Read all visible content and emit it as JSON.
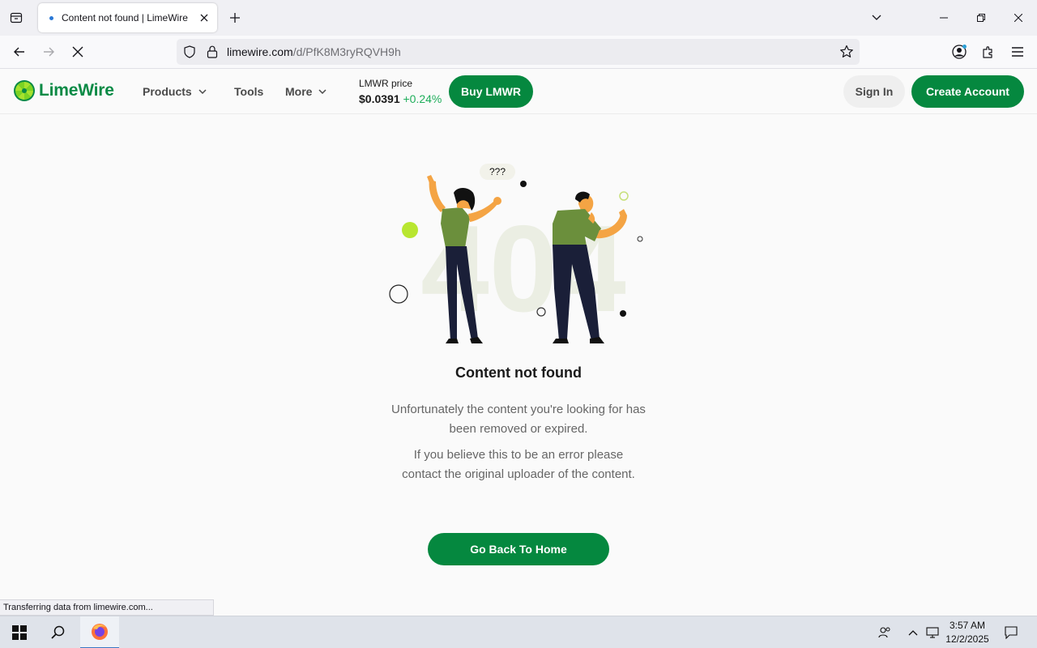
{
  "browser": {
    "tab_title": "Content not found | LimeWire",
    "url_domain": "limewire.com",
    "url_path": "/d/PfK8M3ryRQVH9h",
    "status_text": "Transferring data from limewire.com..."
  },
  "site": {
    "logo_text": "LimeWire",
    "brand_color": "#05883f",
    "nav": {
      "products": "Products",
      "tools": "Tools",
      "more": "More"
    },
    "price": {
      "label": "LMWR price",
      "value": "$0.0391",
      "change": "+0.24%"
    },
    "buy_label": "Buy LMWR",
    "signin_label": "Sign In",
    "create_label": "Create Account"
  },
  "main": {
    "illustration_bubble": "???",
    "illustration_number": "404",
    "title": "Content not found",
    "text1": "Unfortunately the content you're looking for has been removed or expired.",
    "text2": "If you believe this to be an error please contact the original uploader of the content.",
    "home_button": "Go Back To Home"
  },
  "taskbar": {
    "time": "3:57 AM",
    "date": "12/2/2025"
  }
}
